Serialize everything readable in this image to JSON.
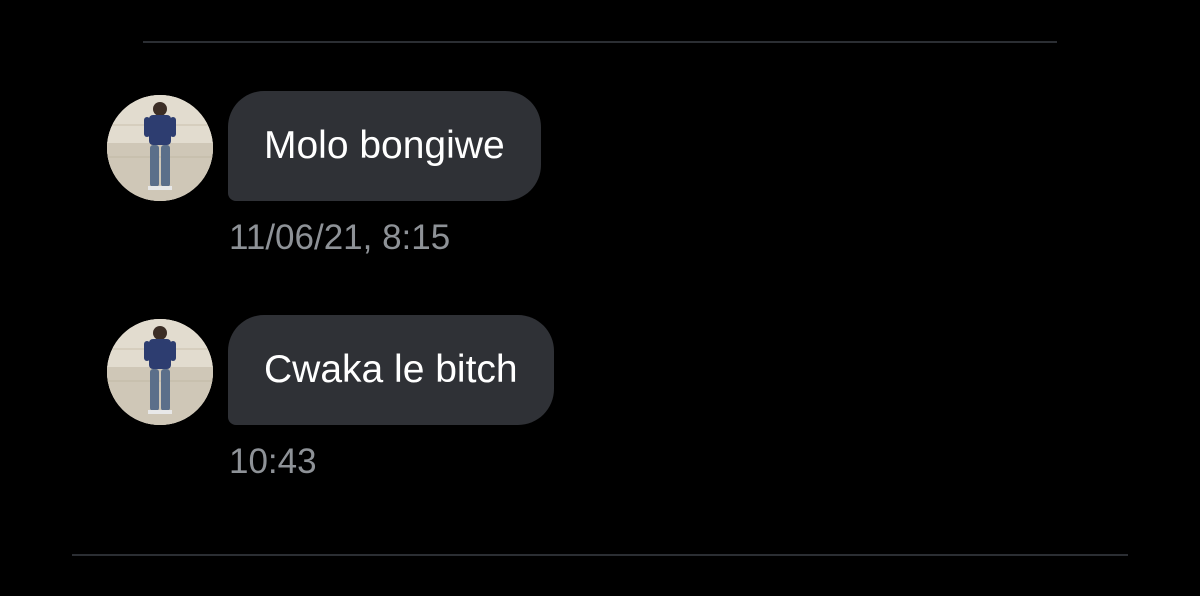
{
  "conversation": {
    "messages": [
      {
        "text": "Molo bongiwe",
        "timestamp": "11/06/21, 8:15"
      },
      {
        "text": "Cwaka le bitch",
        "timestamp": "10:43"
      }
    ]
  },
  "colors": {
    "background": "#000000",
    "bubble": "#2f3136",
    "text": "#ffffff",
    "timestamp": "#8e9297",
    "divider": "#2b2e33"
  },
  "icons": {
    "avatar": "user-avatar-photo"
  }
}
